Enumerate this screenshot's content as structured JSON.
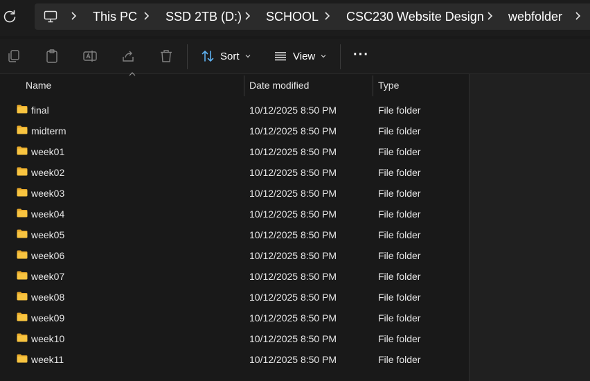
{
  "breadcrumb": {
    "items": [
      "This PC",
      "SSD 2TB (D:)",
      "SCHOOL",
      "CSC230 Website Design",
      "webfolder"
    ]
  },
  "commandbar": {
    "sort_label": "Sort",
    "view_label": "View",
    "more_label": "···"
  },
  "columns": {
    "name": "Name",
    "date_modified": "Date modified",
    "type": "Type"
  },
  "rows": [
    {
      "name": "final",
      "date": "10/12/2025 8:50 PM",
      "type": "File folder"
    },
    {
      "name": "midterm",
      "date": "10/12/2025 8:50 PM",
      "type": "File folder"
    },
    {
      "name": "week01",
      "date": "10/12/2025 8:50 PM",
      "type": "File folder"
    },
    {
      "name": "week02",
      "date": "10/12/2025 8:50 PM",
      "type": "File folder"
    },
    {
      "name": "week03",
      "date": "10/12/2025 8:50 PM",
      "type": "File folder"
    },
    {
      "name": "week04",
      "date": "10/12/2025 8:50 PM",
      "type": "File folder"
    },
    {
      "name": "week05",
      "date": "10/12/2025 8:50 PM",
      "type": "File folder"
    },
    {
      "name": "week06",
      "date": "10/12/2025 8:50 PM",
      "type": "File folder"
    },
    {
      "name": "week07",
      "date": "10/12/2025 8:50 PM",
      "type": "File folder"
    },
    {
      "name": "week08",
      "date": "10/12/2025 8:50 PM",
      "type": "File folder"
    },
    {
      "name": "week09",
      "date": "10/12/2025 8:50 PM",
      "type": "File folder"
    },
    {
      "name": "week10",
      "date": "10/12/2025 8:50 PM",
      "type": "File folder"
    },
    {
      "name": "week11",
      "date": "10/12/2025 8:50 PM",
      "type": "File folder"
    }
  ],
  "colors": {
    "folder_body": "#f8c440",
    "folder_tab": "#e7a92a",
    "background": "#191919"
  },
  "icons": [
    "refresh-icon",
    "this-pc-icon",
    "chevron-right-icon",
    "copy-icon",
    "paste-icon",
    "rename-icon",
    "share-icon",
    "delete-icon",
    "sort-icon",
    "view-icon",
    "more-icon",
    "folder-icon"
  ]
}
